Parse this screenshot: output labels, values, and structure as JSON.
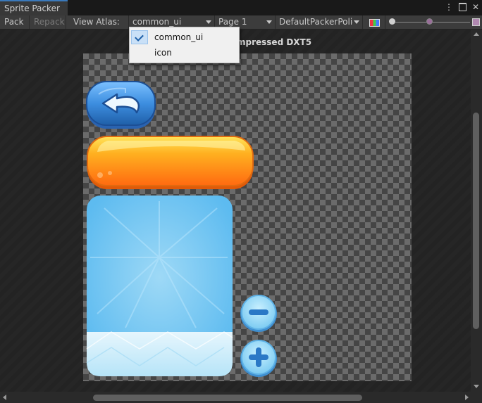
{
  "window": {
    "tab_title": "Sprite Packer"
  },
  "toolbar": {
    "pack_label": "Pack",
    "repack_label": "Repack",
    "view_atlas_label": "View Atlas:",
    "atlas_selected": "common_ui",
    "page_selected": "Page 1",
    "policy_selected": "DefaultPackerPolicy"
  },
  "viewer": {
    "format_info_partial": "mpressed DXT5"
  },
  "dropdown": {
    "items": [
      {
        "label": "common_ui",
        "checked": true
      },
      {
        "label": "icon",
        "checked": false
      }
    ]
  },
  "sprites": [
    {
      "name": "back-button-sprite",
      "icon": "undo-arrow-icon",
      "color": "#3d8ee0"
    },
    {
      "name": "orange-bar-sprite",
      "color": "#ff9b1e"
    },
    {
      "name": "panel-sprite",
      "color": "#6ac4f2"
    },
    {
      "name": "minus-button-sprite",
      "icon": "minus-icon",
      "color": "#8fd8fa"
    },
    {
      "name": "plus-button-sprite",
      "icon": "plus-icon",
      "color": "#8fd8fa"
    }
  ],
  "colors": {
    "accent": "#3a79bb",
    "checker_light": "#6b6b6b",
    "checker_dark": "#454545"
  }
}
